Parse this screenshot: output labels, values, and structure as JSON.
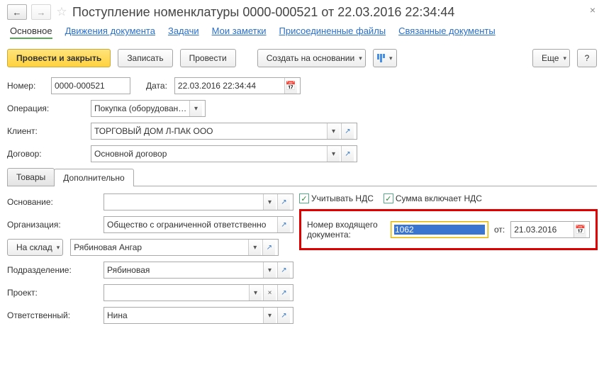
{
  "header": {
    "title": "Поступление номенклатуры 0000-000521 от 22.03.2016 22:34:44",
    "back_arrow": "←",
    "forward_arrow": "→",
    "star": "☆",
    "close": "×"
  },
  "nav": {
    "main": "Основное",
    "movements": "Движения документа",
    "tasks": "Задачи",
    "notes": "Мои заметки",
    "attachments": "Присоединенные файлы",
    "related": "Связанные документы"
  },
  "toolbar": {
    "post_close": "Провести и закрыть",
    "save": "Записать",
    "post": "Провести",
    "create_based": "Создать на основании",
    "more": "Еще",
    "help": "?"
  },
  "fields": {
    "number_label": "Номер:",
    "number_value": "0000-000521",
    "date_label": "Дата:",
    "date_value": "22.03.2016 22:34:44",
    "operation_label": "Операция:",
    "operation_value": "Покупка (оборудование, т",
    "client_label": "Клиент:",
    "client_value": "ТОРГОВЫЙ ДОМ Л-ПАК ООО",
    "contract_label": "Договор:",
    "contract_value": "Основной договор"
  },
  "tabs": {
    "goods": "Товары",
    "additional": "Дополнительно"
  },
  "additional": {
    "basis_label": "Основание:",
    "basis_value": "",
    "org_label": "Организация:",
    "org_value": "Общество с ограниченной ответственно",
    "to_warehouse": "На склад",
    "warehouse_value": "Рябиновая Ангар",
    "department_label": "Подразделение:",
    "department_value": "Рябиновая",
    "project_label": "Проект:",
    "project_value": "",
    "responsible_label": "Ответственный:",
    "responsible_value": "Нина",
    "include_vat": "Учитывать НДС",
    "sum_includes_vat": "Сумма включает НДС",
    "incoming_doc_label": "Номер входящего документа:",
    "incoming_doc_value": "1062",
    "incoming_from_label": "от:",
    "incoming_from_value": "21.03.2016"
  },
  "glyphs": {
    "caret": "▾",
    "dots": "…",
    "open": "↗",
    "calendar": "📅",
    "check": "✓",
    "clear": "×"
  }
}
